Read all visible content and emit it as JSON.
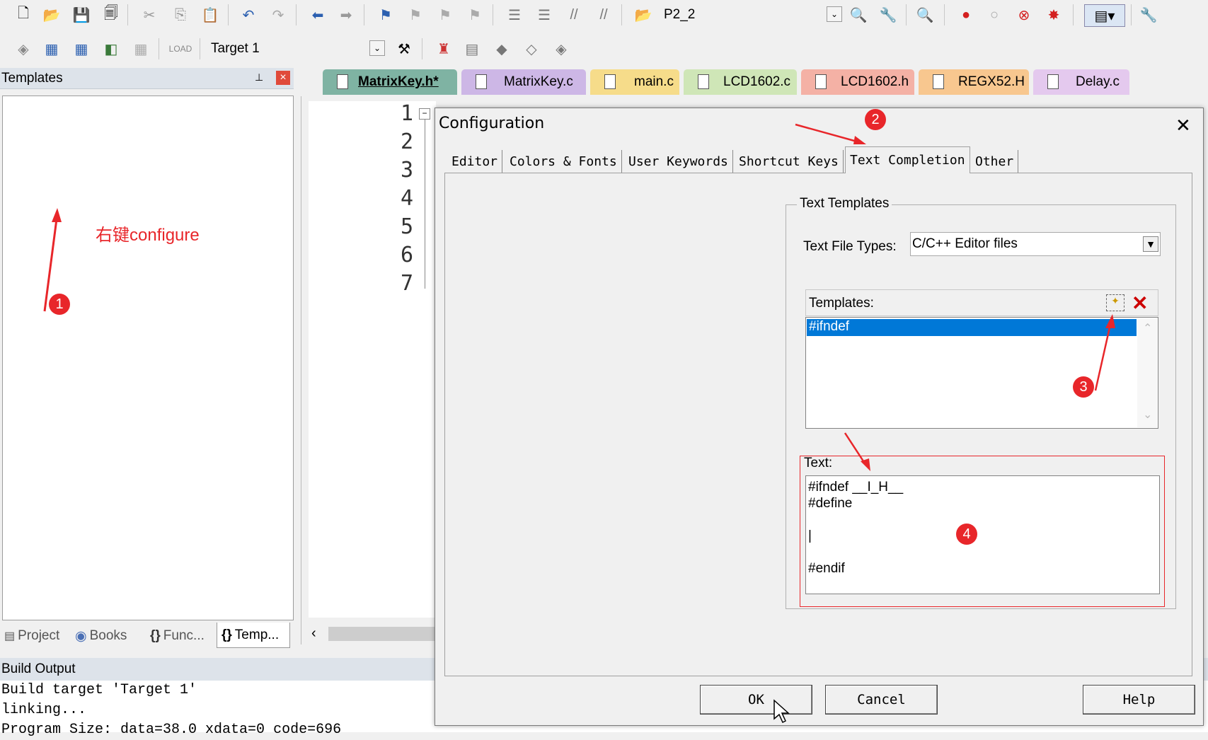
{
  "toolbar1": {
    "dropdown_value": "P2_2"
  },
  "toolbar2": {
    "target_value": "Target 1"
  },
  "left_panel": {
    "title": "Templates",
    "pin_glyph": "📌",
    "close_glyph": "×",
    "annotation_text": "右键configure",
    "bottom_tabs": [
      {
        "label": "Project"
      },
      {
        "label": "Books"
      },
      {
        "label": "Func..."
      },
      {
        "label": "Temp..."
      }
    ]
  },
  "editor": {
    "tabs": [
      {
        "label": "MatrixKey.h*",
        "color": "#7fb3a3"
      },
      {
        "label": "MatrixKey.c",
        "color": "#cdb7e6"
      },
      {
        "label": "main.c",
        "color": "#f6dc8a"
      },
      {
        "label": "LCD1602.c",
        "color": "#cfe6b7"
      },
      {
        "label": "LCD1602.h",
        "color": "#f4b1a5"
      },
      {
        "label": "REGX52.H",
        "color": "#f8c78f"
      },
      {
        "label": "Delay.c",
        "color": "#e4c9ee"
      }
    ],
    "line_numbers": [
      "1",
      "2",
      "3",
      "4",
      "5",
      "6",
      "7"
    ]
  },
  "build_output": {
    "title": "Build Output",
    "lines": [
      "Build target 'Target 1'",
      "linking...",
      "Program Size: data=38.0 xdata=0 code=696"
    ]
  },
  "dialog": {
    "title": "Configuration",
    "close_glyph": "✕",
    "tabs": [
      "Editor",
      "Colors & Fonts",
      "User Keywords",
      "Shortcut Keys",
      "Text Completion",
      "Other"
    ],
    "active_tab": "Text Completion",
    "group_title": "Text Templates",
    "file_types_label": "Text File Types:",
    "file_types_value": "C/C++ Editor files",
    "templates_label": "Templates:",
    "templates": [
      "#ifndef"
    ],
    "text_label": "Text:",
    "text_lines": [
      "#ifndef __I_H__",
      "#define",
      "",
      "|",
      "",
      "#endif"
    ],
    "buttons": {
      "ok": "OK",
      "cancel": "Cancel",
      "help": "Help"
    }
  },
  "annotations": [
    "1",
    "2",
    "3",
    "4"
  ],
  "colors": {
    "annotation_red": "#e8262a",
    "selection_blue": "#0078d7",
    "panel_title_bg": "#dde3ea"
  }
}
